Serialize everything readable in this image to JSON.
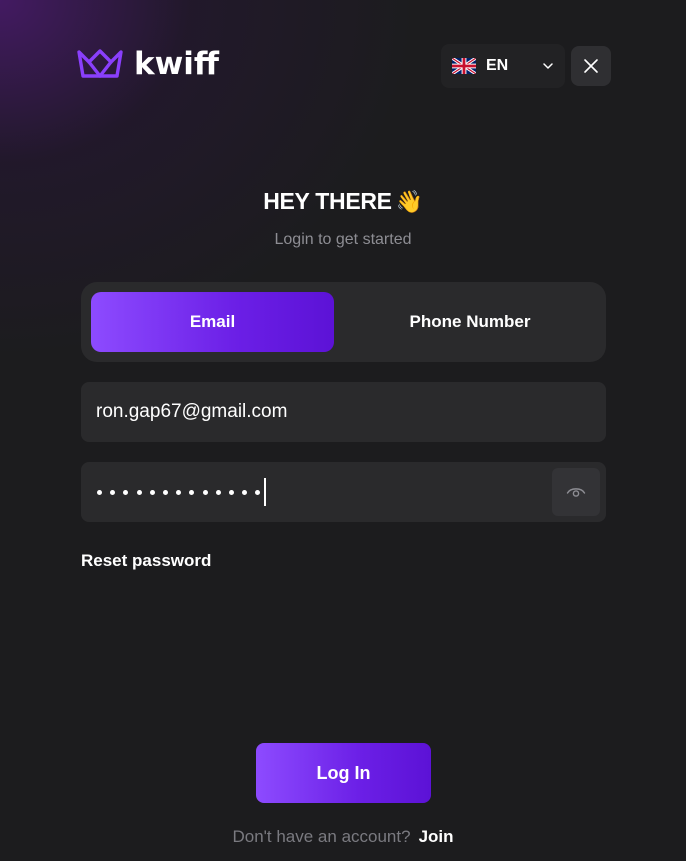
{
  "brand": {
    "name": "kwiff",
    "accent_color": "#7b2ff7",
    "crown_color": "#8a3ffc"
  },
  "header": {
    "language_code": "EN",
    "flag_icon": "uk-flag-icon",
    "chevron_icon": "chevron-down-icon",
    "close_icon": "close-icon"
  },
  "hero": {
    "title": "HEY THERE",
    "emoji": "👋",
    "subtitle": "Login to get started"
  },
  "tabs": [
    {
      "label": "Email",
      "active": true
    },
    {
      "label": "Phone Number",
      "active": false
    }
  ],
  "form": {
    "email_value": "ron.gap67@gmail.com",
    "password_value": "•••••••••••••",
    "password_length": 13,
    "eye_icon": "eye-icon",
    "reset_label": "Reset password",
    "login_label": "Log In"
  },
  "footer": {
    "prompt": "Don't have an account?",
    "join_label": "Join"
  },
  "colors": {
    "background": "#1c1c1e",
    "surface": "#2a2a2c",
    "button_gradient_start": "#8d4bff",
    "button_gradient_end": "#5c12d6",
    "muted_text": "#8d8d93"
  }
}
